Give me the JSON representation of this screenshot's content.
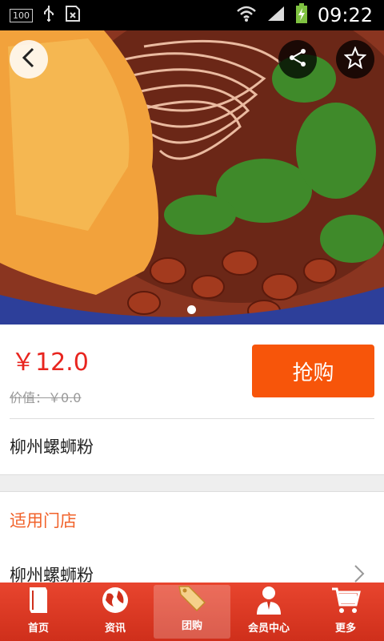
{
  "status_bar": {
    "battery_badge": "100",
    "time": "09:22"
  },
  "hero": {
    "page_indicator_count": 1,
    "active_index": 0
  },
  "product": {
    "price": "￥12.0",
    "original_value": "价值：￥0.0",
    "buy_label": "抢购",
    "name": "柳州螺蛳粉"
  },
  "stores": {
    "section_title": "适用门店",
    "items": [
      {
        "name": "柳州螺蛳粉"
      }
    ]
  },
  "tabbar": {
    "active": 2,
    "items": [
      {
        "label": "首页",
        "icon": "book-icon"
      },
      {
        "label": "资讯",
        "icon": "globe-icon"
      },
      {
        "label": "团购",
        "icon": "sale-tag-icon"
      },
      {
        "label": "会员中心",
        "icon": "member-icon"
      },
      {
        "label": "更多",
        "icon": "cart-icon"
      }
    ]
  },
  "colors": {
    "accent": "#f7550a",
    "price": "#e8251f",
    "section_title": "#f1622a",
    "tabbar": "#d93a24"
  }
}
